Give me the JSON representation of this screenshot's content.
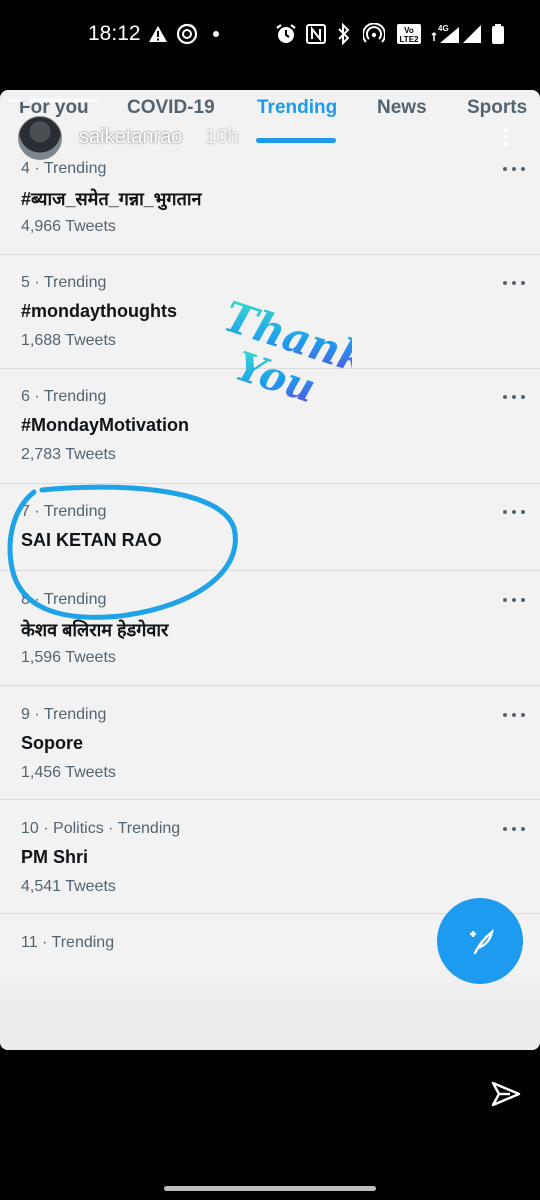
{
  "status_bar": {
    "time": "18:12",
    "icons": [
      "warning-icon",
      "music-app-icon",
      "notification-dot",
      "alarm-icon",
      "nfc-icon",
      "bluetooth-icon",
      "hotspot-icon",
      "volte-icon",
      "signal-4g-icon",
      "signal-icon",
      "battery-icon"
    ],
    "volte_label": "Vo LTE 2",
    "network_label": "4G"
  },
  "story": {
    "username": "saiketanrao",
    "age": "10h"
  },
  "tabs": [
    {
      "label": "For you"
    },
    {
      "label": "COVID-19"
    },
    {
      "label": "Trending",
      "active": true
    },
    {
      "label": "News"
    },
    {
      "label": "Sports"
    }
  ],
  "trends": [
    {
      "meta": "4 · Trending",
      "name": "#ब्याज_समेत_गन्ना_भुगतान",
      "count": "4,966 Tweets"
    },
    {
      "meta": "5 · Trending",
      "name": "#mondaythoughts",
      "count": "1,688 Tweets"
    },
    {
      "meta": "6 · Trending",
      "name": "#MondayMotivation",
      "count": "2,783 Tweets"
    },
    {
      "meta": "7 · Trending",
      "name": "SAI KETAN RAO",
      "count": ""
    },
    {
      "meta": "8 · Trending",
      "name": "केशव बलिराम हेडगेवार",
      "count": "1,596 Tweets"
    },
    {
      "meta": "9 · Trending",
      "name": "Sopore",
      "count": "1,456 Tweets"
    },
    {
      "meta": "10 · Politics · Trending",
      "name": "PM Shri",
      "count": "4,541 Tweets"
    },
    {
      "meta": "11 · Trending",
      "name": "",
      "count": ""
    }
  ],
  "sticker": {
    "line1": "Thank",
    "line2": "You"
  },
  "colors": {
    "accent": "#1d9bf0",
    "circle": "#1fa3e8",
    "sticker_start": "#3fe3c7",
    "sticker_end": "#6a3fe0"
  }
}
